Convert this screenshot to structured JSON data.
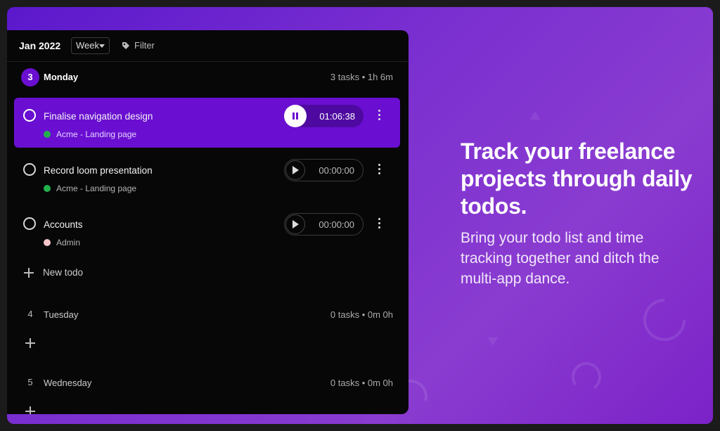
{
  "calendar": {
    "month": "Jan 2022",
    "view": "Week",
    "filter_label": "Filter"
  },
  "days": [
    {
      "num": "3",
      "name": "Monday",
      "tasks_count": "3 tasks",
      "duration": "1h 6m",
      "tasks": [
        {
          "title": "Finalise navigation design",
          "project": "Acme - Landing page",
          "project_color": "#22b14c",
          "time": "01:06:38",
          "state": "running"
        },
        {
          "title": "Record loom presentation",
          "project": "Acme - Landing page",
          "project_color": "#22b14c",
          "time": "00:00:00",
          "state": "stopped"
        },
        {
          "title": "Accounts",
          "project": "Admin",
          "project_color": "#f7c6cd",
          "time": "00:00:00",
          "state": "stopped"
        }
      ],
      "new_todo_label": "New todo"
    },
    {
      "num": "4",
      "name": "Tuesday",
      "tasks_count": "0 tasks",
      "duration": "0m 0h"
    },
    {
      "num": "5",
      "name": "Wednesday",
      "tasks_count": "0 tasks",
      "duration": "0m 0h"
    }
  ],
  "marketing": {
    "headline": "Track your freelance projects through daily todos.",
    "subtext": "Bring your todo list and time tracking together and ditch the multi-app dance."
  },
  "colors": {
    "accent": "#6a0fd1",
    "background": "#070707"
  }
}
